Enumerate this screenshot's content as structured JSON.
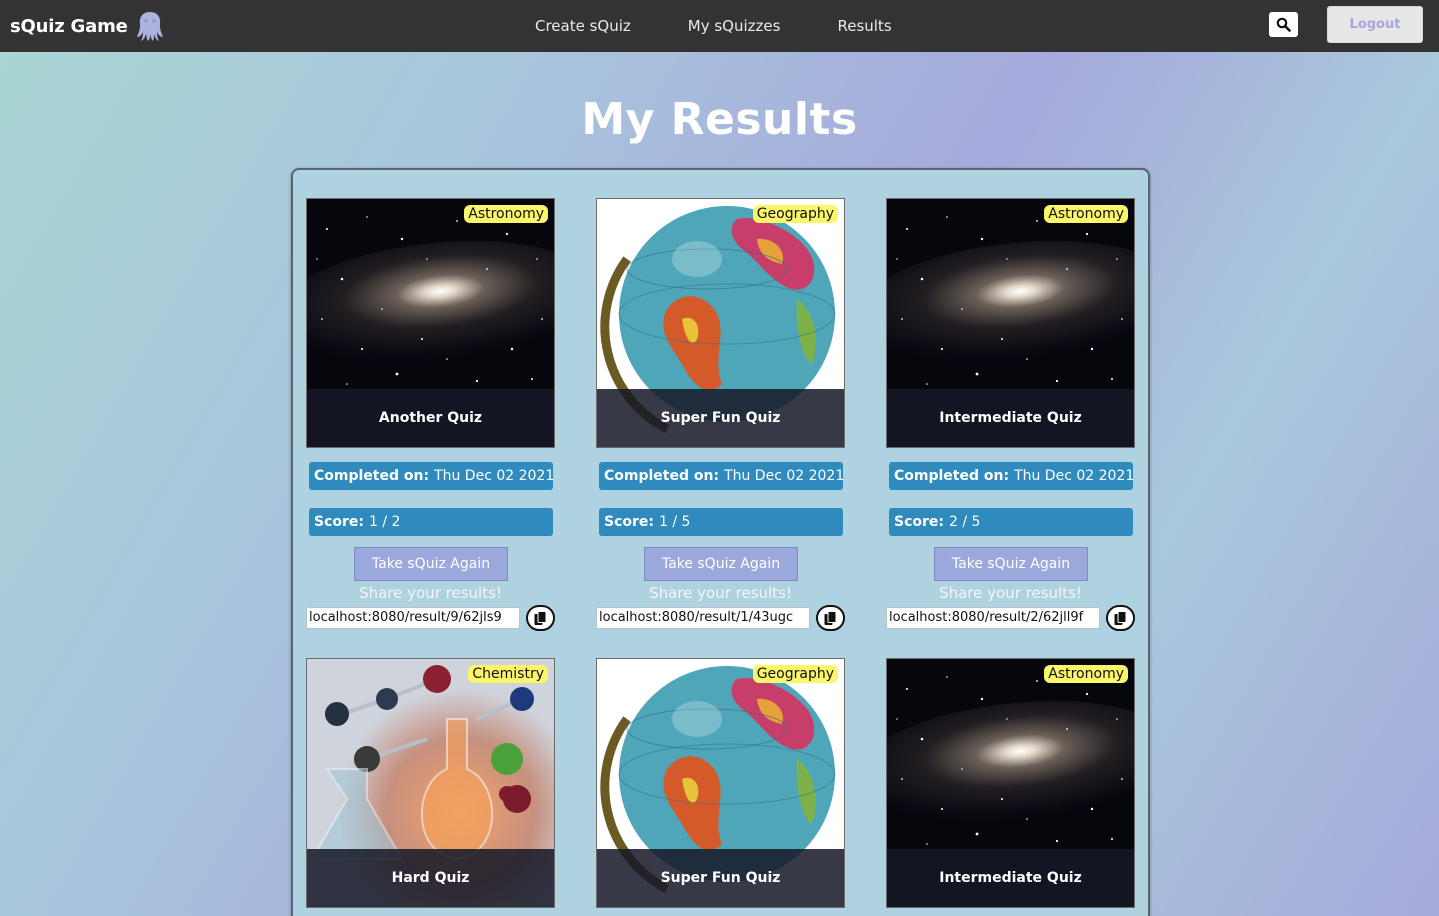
{
  "app": {
    "brand": "sQuiz Game"
  },
  "nav": {
    "links": [
      "Create sQuiz",
      "My sQuizzes",
      "Results"
    ],
    "logout": "Logout"
  },
  "page": {
    "title": "My Results"
  },
  "labels": {
    "completed": "Completed on:",
    "score": "Score:",
    "retake": "Take sQuiz Again",
    "share": "Share your results!"
  },
  "results": [
    {
      "category": "Astronomy",
      "image": "galaxy",
      "name": "Another Quiz",
      "date": "Thu Dec 02 2021",
      "score": "1 / 2",
      "link": "localhost:8080/result/9/62jls9"
    },
    {
      "category": "Geography",
      "image": "globe",
      "name": "Super Fun Quiz",
      "date": "Thu Dec 02 2021",
      "score": "1 / 5",
      "link": "localhost:8080/result/1/43ugc"
    },
    {
      "category": "Astronomy",
      "image": "galaxy",
      "name": "Intermediate Quiz",
      "date": "Thu Dec 02 2021",
      "score": "2 / 5",
      "link": "localhost:8080/result/2/62jll9f"
    },
    {
      "category": "Chemistry",
      "image": "chemistry",
      "name": "Hard Quiz"
    },
    {
      "category": "Geography",
      "image": "globe",
      "name": "Super Fun Quiz"
    },
    {
      "category": "Astronomy",
      "image": "galaxy",
      "name": "Intermediate Quiz"
    }
  ],
  "colors": {
    "navbar": "#333333",
    "info_bar": "#2f8bbd",
    "retake_button": "#9ba8dc",
    "tag": "#fbf56a"
  },
  "icons": {
    "logo": "octopus-logo-icon",
    "search": "search-icon",
    "copy": "copy-icon"
  }
}
